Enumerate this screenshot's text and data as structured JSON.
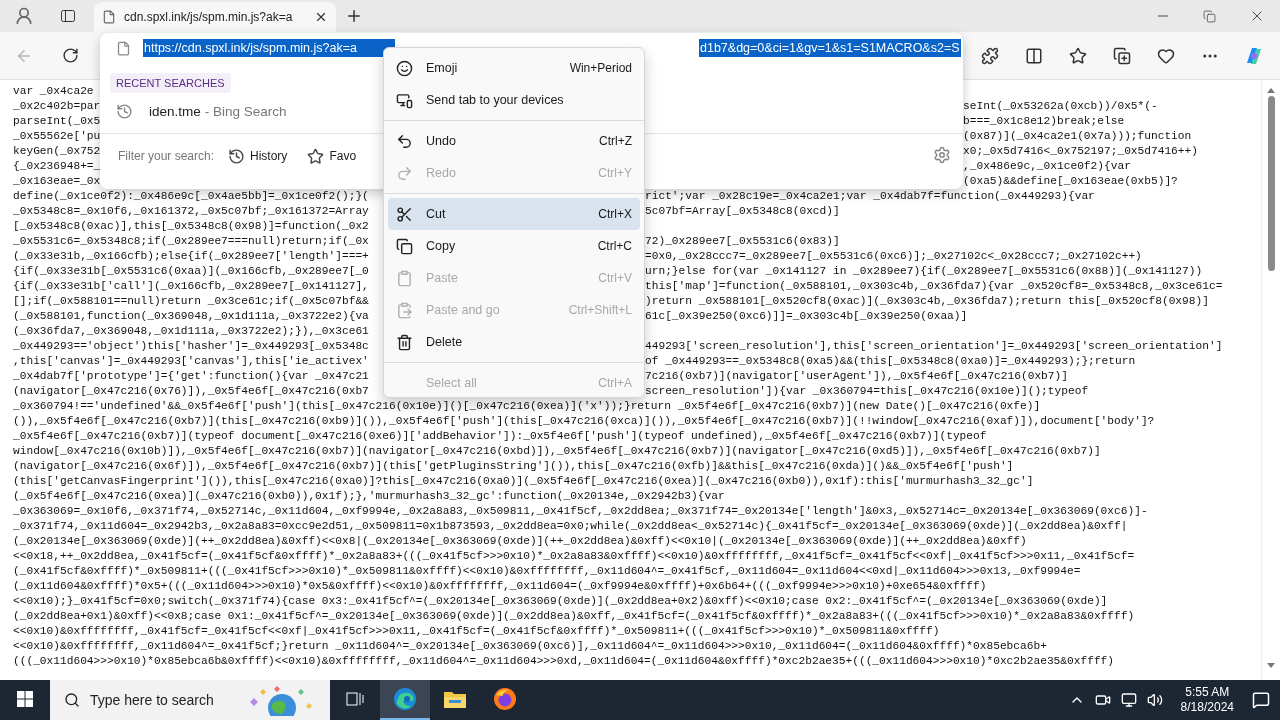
{
  "tab_bar": {
    "tabs": [
      {
        "title": "cdn.spxl.ink/js/spm.min.js?ak=a",
        "selected": true
      }
    ]
  },
  "toolbar": {
    "back": {
      "disabled": true
    }
  },
  "address": {
    "url_start": "https://cdn.spxl.ink/js/spm.min.js?ak=a",
    "url_end": "d1b7&dg=0&ci=1&gv=1&s1=S1MACRO&s2=S",
    "selected": true
  },
  "suggestions": {
    "heading": "RECENT SEARCHES",
    "items": [
      {
        "query": "iden.tme",
        "source": "- Bing Search"
      }
    ],
    "filter_label": "Filter your search:",
    "filters": [
      {
        "kind": "history",
        "label": "History"
      },
      {
        "kind": "favorites",
        "label": "Favo"
      }
    ]
  },
  "context_menu": {
    "items": [
      {
        "kind": "emoji",
        "label": "Emoji",
        "shortcut": "Win+Period",
        "disabled": false,
        "highlighted": false
      },
      {
        "kind": "send",
        "label": "Send tab to your devices",
        "disabled": false,
        "highlighted": false
      },
      {
        "kind": "separator"
      },
      {
        "kind": "undo",
        "label": "Undo",
        "shortcut": "Ctrl+Z",
        "disabled": false,
        "highlighted": false
      },
      {
        "kind": "redo",
        "label": "Redo",
        "shortcut": "Ctrl+Y",
        "disabled": true,
        "highlighted": false
      },
      {
        "kind": "separator"
      },
      {
        "kind": "cut",
        "label": "Cut",
        "shortcut": "Ctrl+X",
        "disabled": false,
        "highlighted": true
      },
      {
        "kind": "copy",
        "label": "Copy",
        "shortcut": "Ctrl+C",
        "disabled": false,
        "highlighted": false
      },
      {
        "kind": "paste",
        "label": "Paste",
        "shortcut": "Ctrl+V",
        "disabled": true,
        "highlighted": false
      },
      {
        "kind": "paste-go",
        "label": "Paste and go",
        "shortcut": "Ctrl+Shift+L",
        "disabled": true,
        "highlighted": false
      },
      {
        "kind": "delete",
        "label": "Delete",
        "disabled": false,
        "highlighted": false
      },
      {
        "kind": "separator"
      },
      {
        "kind": "select-all",
        "label": "Select all",
        "shortcut": "Ctrl+A",
        "disabled": true,
        "highlighted": false
      }
    ]
  },
  "code_lines": [
    {
      "kind": "address",
      "left": "var _0x4ca2e"
    },
    {
      "kind": "address",
      "left": "_0x2c402b=par",
      "right": "seInt(_0x53262a(0xcb))/0x5*(-"
    },
    {
      "kind": "address",
      "left": "parseInt(_0x5",
      "right": "b===_0x1c8e12)break;else"
    },
    {
      "kind": "address",
      "left": "_0x55562e['pu",
      "right": "(0x87)](_0x4ca2e1(0x7a)));function"
    },
    {
      "kind": "address",
      "left": "keyGen(_0x752",
      "right": "x0;_0x5d7416<_0x752197;_0x5d7416++)"
    },
    {
      "kind": "address",
      "left": "{_0x236948+=_",
      "right": ",_0x486e9c,_0x1ce0f2){var"
    },
    {
      "kind": "address",
      "left": "_0x163eae=_0x",
      "right": "(0xa5)&&define[_0x163eae(0xb5)]?"
    },
    {
      "kind": "menu",
      "left": "define(_0x1ce0f2):_0x486e9c[_0x4ae5bb]=_0x1ce0f2();}(",
      "right": "rict';var _0x28c19e=_0x4ca2e1;var _0x4dab7f=function(_0x449293){var"
    },
    {
      "kind": "menu",
      "left": "_0x5348c8=_0x10f6,_0x161372,_0x5c07bf;_0x161372=Array",
      "right": "5c07bf=Array[_0x5348c8(0xcd)]"
    },
    {
      "kind": "menu",
      "left": "[_0x5348c8(0xac)],this[_0x5348c8(0x98)]=function(_0x2"
    },
    {
      "kind": "menu",
      "left": "_0x5531c6=_0x5348c8;if(_0x289ee7===null)return;if(_0x",
      "right": "72)_0x289ee7[_0x5531c6(0x83)]"
    },
    {
      "kind": "menu",
      "left": "(_0x33e31b,_0x166cfb);else{if(_0x289ee7['length']===+",
      "right": "=0x0,_0x28ccc7=_0x289ee7[_0x5531c6(0xc6)];_0x27102c<_0x28ccc7;_0x27102c++)"
    },
    {
      "kind": "menu",
      "left": "{if(_0x33e31b[_0x5531c6(0xaa)](_0x166cfb,_0x289ee7[_0",
      "right": "urn;}else for(var _0x141127 in _0x289ee7){if(_0x289ee7[_0x5531c6(0x88)](_0x141127))"
    },
    {
      "kind": "menu",
      "left": "{if(_0x33e31b['call'](_0x166cfb,_0x289ee7[_0x141127],",
      "right": "this['map']=function(_0x588101,_0x303c4b,_0x36fda7){var _0x520cf8=_0x5348c8,_0x3ce61c="
    },
    {
      "kind": "menu",
      "left": "[];if(_0x588101==null)return _0x3ce61c;if(_0x5c07bf&&",
      "right": ")return _0x588101[_0x520cf8(0xac)](_0x303c4b,_0x36fda7);return this[_0x520cf8(0x98)]"
    },
    {
      "kind": "menu",
      "left": "(_0x588101,function(_0x369048,_0x1d111a,_0x3722e2){va",
      "right": "61c[_0x39e250(0xc6)]]=_0x303c4b[_0x39e250(0xaa)]"
    },
    {
      "kind": "menu",
      "left": "(_0x36fda7,_0x369048,_0x1d111a,_0x3722e2);}),_0x3ce61"
    },
    {
      "kind": "menu",
      "left": "_0x449293=='object')this['hasher']=_0x449293[_0x5348c",
      "right": "449293['screen_resolution'],this['screen_orientation']=_0x449293['screen_orientation']"
    },
    {
      "kind": "menu",
      "left": ",this['canvas']=_0x449293['canvas'],this['ie_activex'",
      "right": "of _0x449293==_0x5348c8(0xa5)&&(this[_0x5348c8(0xa0)]=_0x449293);};return"
    },
    {
      "kind": "menu",
      "left": "_0x4dab7f['prototype']={'get':function(){var _0x47c21",
      "right": "7c216(0xb7)](navigator['userAgent']),_0x5f4e6f[_0x47c216(0xb7)]"
    },
    {
      "kind": "menu",
      "left": "(navigator[_0x47c216(0x76)]),_0x5f4e6f[_0x47c216(0xb7",
      "right": "screen_resolution']){var _0x360794=this[_0x47c216(0x10e)]();typeof"
    },
    {
      "kind": "full",
      "text": "_0x360794!=='undefined'&&_0x5f4e6f['push'](this[_0x47c216(0x10e)]()[_0x47c216(0xea)]('x'));}return _0x5f4e6f[_0x47c216(0xb7)](new Date()[_0x47c216(0xfe)]"
    },
    {
      "kind": "full",
      "text": "()),_0x5f4e6f[_0x47c216(0xb7)](this[_0x47c216(0xb9)]()),_0x5f4e6f['push'](this[_0x47c216(0xca)]()),_0x5f4e6f[_0x47c216(0xb7)](!!window[_0x47c216(0xaf)]),document['body']?"
    },
    {
      "kind": "full",
      "text": "_0x5f4e6f[_0x47c216(0xb7)](typeof document[_0x47c216(0xe6)]['addBehavior']):_0x5f4e6f['push'](typeof undefined),_0x5f4e6f[_0x47c216(0xb7)](typeof"
    },
    {
      "kind": "full",
      "text": "window[_0x47c216(0x10b)]),_0x5f4e6f[_0x47c216(0xb7)](navigator[_0x47c216(0xbd)]),_0x5f4e6f[_0x47c216(0xb7)](navigator[_0x47c216(0xd5)]),_0x5f4e6f[_0x47c216(0xb7)]"
    },
    {
      "kind": "full",
      "text": "(navigator[_0x47c216(0x6f)]),_0x5f4e6f[_0x47c216(0xb7)](this['getPluginsString']()),this[_0x47c216(0xfb)]&&this[_0x47c216(0xda)]()&&_0x5f4e6f['push']"
    },
    {
      "kind": "full",
      "text": "(this['getCanvasFingerprint']()),this[_0x47c216(0xa0)]?this[_0x47c216(0xa0)](_0x5f4e6f[_0x47c216(0xea)](_0x47c216(0xb0)),0x1f):this['murmurhash3_32_gc']"
    },
    {
      "kind": "full",
      "text": "(_0x5f4e6f[_0x47c216(0xea)](_0x47c216(0xb0)),0x1f);},'murmurhash3_32_gc':function(_0x20134e,_0x2942b3){var"
    },
    {
      "kind": "full",
      "text": "_0x363069=_0x10f6,_0x371f74,_0x52714c,_0x11d604,_0xf9994e,_0x2a8a83,_0x509811,_0x41f5cf,_0x2dd8ea;_0x371f74=_0x20134e['length']&0x3,_0x52714c=_0x20134e[_0x363069(0xc6)]-"
    },
    {
      "kind": "full",
      "text": "_0x371f74,_0x11d604=_0x2942b3,_0x2a8a83=0xcc9e2d51,_0x509811=0x1b873593,_0x2dd8ea=0x0;while(_0x2dd8ea<_0x52714c){_0x41f5cf=_0x20134e[_0x363069(0xde)](_0x2dd8ea)&0xff|"
    },
    {
      "kind": "full",
      "text": "(_0x20134e[_0x363069(0xde)](++_0x2dd8ea)&0xff)<<0x8|(_0x20134e[_0x363069(0xde)](++_0x2dd8ea)&0xff)<<0x10|(_0x20134e[_0x363069(0xde)](++_0x2dd8ea)&0xff)"
    },
    {
      "kind": "full",
      "text": "<<0x18,++_0x2dd8ea,_0x41f5cf=(_0x41f5cf&0xffff)*_0x2a8a83+(((_0x41f5cf>>>0x10)*_0x2a8a83&0xffff)<<0x10)&0xffffffff,_0x41f5cf=_0x41f5cf<<0xf|_0x41f5cf>>>0x11,_0x41f5cf="
    },
    {
      "kind": "full",
      "text": "(_0x41f5cf&0xffff)*_0x509811+(((_0x41f5cf>>>0x10)*_0x509811&0xffff)<<0x10)&0xffffffff,_0x11d604^=_0x41f5cf,_0x11d604=_0x11d604<<0xd|_0x11d604>>>0x13,_0xf9994e="
    },
    {
      "kind": "full",
      "text": "(_0x11d604&0xffff)*0x5+(((_0x11d604>>>0x10)*0x5&0xffff)<<0x10)&0xffffffff,_0x11d604=(_0xf9994e&0xffff)+0x6b64+(((_0xf9994e>>>0x10)+0xe654&0xffff)"
    },
    {
      "kind": "full",
      "text": "<<0x10);}_0x41f5cf=0x0;switch(_0x371f74){case 0x3:_0x41f5cf^=(_0x20134e[_0x363069(0xde)](_0x2dd8ea+0x2)&0xff)<<0x10;case 0x2:_0x41f5cf^=(_0x20134e[_0x363069(0xde)]"
    },
    {
      "kind": "full",
      "text": "(_0x2dd8ea+0x1)&0xff)<<0x8;case 0x1:_0x41f5cf^=_0x20134e[_0x363069(0xde)](_0x2dd8ea)&0xff,_0x41f5cf=(_0x41f5cf&0xffff)*_0x2a8a83+(((_0x41f5cf>>>0x10)*_0x2a8a83&0xffff)"
    },
    {
      "kind": "full",
      "text": "<<0x10)&0xffffffff,_0x41f5cf=_0x41f5cf<<0xf|_0x41f5cf>>>0x11,_0x41f5cf=(_0x41f5cf&0xffff)*_0x509811+(((_0x41f5cf>>>0x10)*_0x509811&0xffff)"
    },
    {
      "kind": "full",
      "text": "<<0x10)&0xffffffff,_0x11d604^=_0x41f5cf;}return _0x11d604^=_0x20134e[_0x363069(0xc6)],_0x11d604^=_0x11d604>>>0x10,_0x11d604=(_0x11d604&0xffff)*0x85ebca6b+"
    },
    {
      "kind": "full",
      "text": "(((_0x11d604>>>0x10)*0x85ebca6b&0xffff)<<0x10)&0xffffffff,_0x11d604^=_0x11d604>>>0xd,_0x11d604=(_0x11d604&0xffff)*0xc2b2ae35+(((_0x11d604>>>0x10)*0xc2b2ae35&0xffff)"
    }
  ],
  "taskbar": {
    "search_placeholder": "Type here to search",
    "apps": [
      {
        "kind": "task-view",
        "selected": false
      },
      {
        "kind": "edge",
        "selected": true
      },
      {
        "kind": "explorer",
        "selected": false
      },
      {
        "kind": "firefox",
        "selected": false
      }
    ],
    "time": "5:55 AM",
    "date": "8/18/2024"
  }
}
